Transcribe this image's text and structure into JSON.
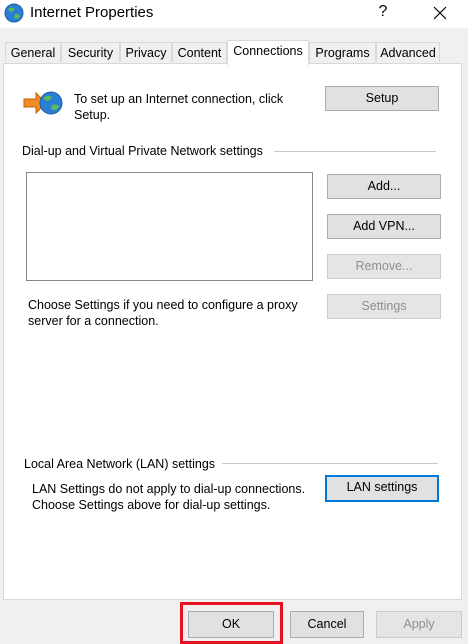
{
  "window": {
    "title": "Internet Properties",
    "help_label": "?",
    "icon": "internet-properties-globe-icon"
  },
  "tabs": [
    {
      "label": "General"
    },
    {
      "label": "Security"
    },
    {
      "label": "Privacy"
    },
    {
      "label": "Content"
    },
    {
      "label": "Connections"
    },
    {
      "label": "Programs"
    },
    {
      "label": "Advanced"
    }
  ],
  "active_tab": "Connections",
  "setup": {
    "text": "To set up an Internet connection, click Setup.",
    "button": "Setup",
    "icon": "network-setup-globe-arrow-icon"
  },
  "dialup": {
    "heading": "Dial-up and Virtual Private Network settings",
    "add_button": "Add...",
    "add_vpn_button": "Add VPN...",
    "remove_button": "Remove...",
    "settings_text": "Choose Settings if you need to configure a proxy server for a connection.",
    "settings_button": "Settings"
  },
  "lan": {
    "heading": "Local Area Network (LAN) settings",
    "text": "LAN Settings do not apply to dial-up connections. Choose Settings above for dial-up settings.",
    "button": "LAN settings"
  },
  "footer": {
    "ok": "OK",
    "cancel": "Cancel",
    "apply": "Apply"
  },
  "colors": {
    "highlight": "#e81123",
    "focus_border": "#0078d7"
  }
}
